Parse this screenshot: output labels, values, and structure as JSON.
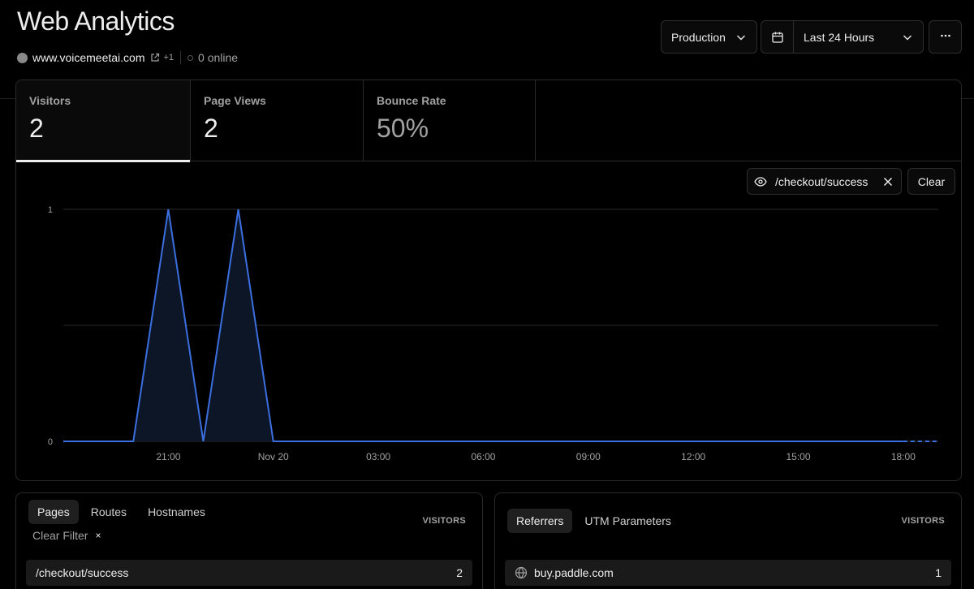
{
  "header": {
    "title": "Web Analytics",
    "domain": "www.voicemeetai.com",
    "extra_count": "+1",
    "online": "0 online"
  },
  "controls": {
    "environment": "Production",
    "date_range": "Last 24 Hours"
  },
  "metrics": [
    {
      "label": "Visitors",
      "value": "2",
      "active": true
    },
    {
      "label": "Page Views",
      "value": "2",
      "active": false
    },
    {
      "label": "Bounce Rate",
      "value": "50%",
      "active": false
    }
  ],
  "filter": {
    "path": "/checkout/success",
    "clear_label": "Clear"
  },
  "chart_data": {
    "type": "area",
    "x_ticks": [
      "21:00",
      "Nov 20",
      "03:00",
      "06:00",
      "09:00",
      "12:00",
      "15:00",
      "18:00"
    ],
    "y_ticks": [
      "1",
      "0"
    ],
    "ylim": [
      0,
      1
    ],
    "series": [
      {
        "color": "#3b6fe0",
        "x_hours": [
          -2,
          -1,
          0,
          1,
          2,
          3,
          4,
          5,
          6,
          7,
          8,
          9,
          10,
          11,
          12,
          13,
          14,
          15,
          16,
          17,
          18,
          19,
          20,
          21,
          22,
          23
        ],
        "values": [
          0,
          0,
          0,
          1,
          0,
          1,
          0,
          0,
          0,
          0,
          0,
          0,
          0,
          0,
          0,
          0,
          0,
          0,
          0,
          0,
          0,
          0,
          0,
          0,
          0,
          0
        ],
        "dashed_from_index": 24
      }
    ],
    "grid": true
  },
  "pages_panel": {
    "tabs": [
      "Pages",
      "Routes",
      "Hostnames"
    ],
    "active_tab": "Pages",
    "column_header": "VISITORS",
    "clear_filter_label": "Clear Filter",
    "clear_filter_x": "×",
    "rows": [
      {
        "label": "/checkout/success",
        "value": "2"
      }
    ]
  },
  "referrers_panel": {
    "tabs": [
      "Referrers",
      "UTM Parameters"
    ],
    "active_tab": "Referrers",
    "column_header": "VISITORS",
    "rows": [
      {
        "label": "buy.paddle.com",
        "value": "1"
      }
    ]
  },
  "colors": {
    "background": "#000000",
    "line": "#3b6fe0",
    "text": "#ededed",
    "muted": "#a1a1a1"
  }
}
